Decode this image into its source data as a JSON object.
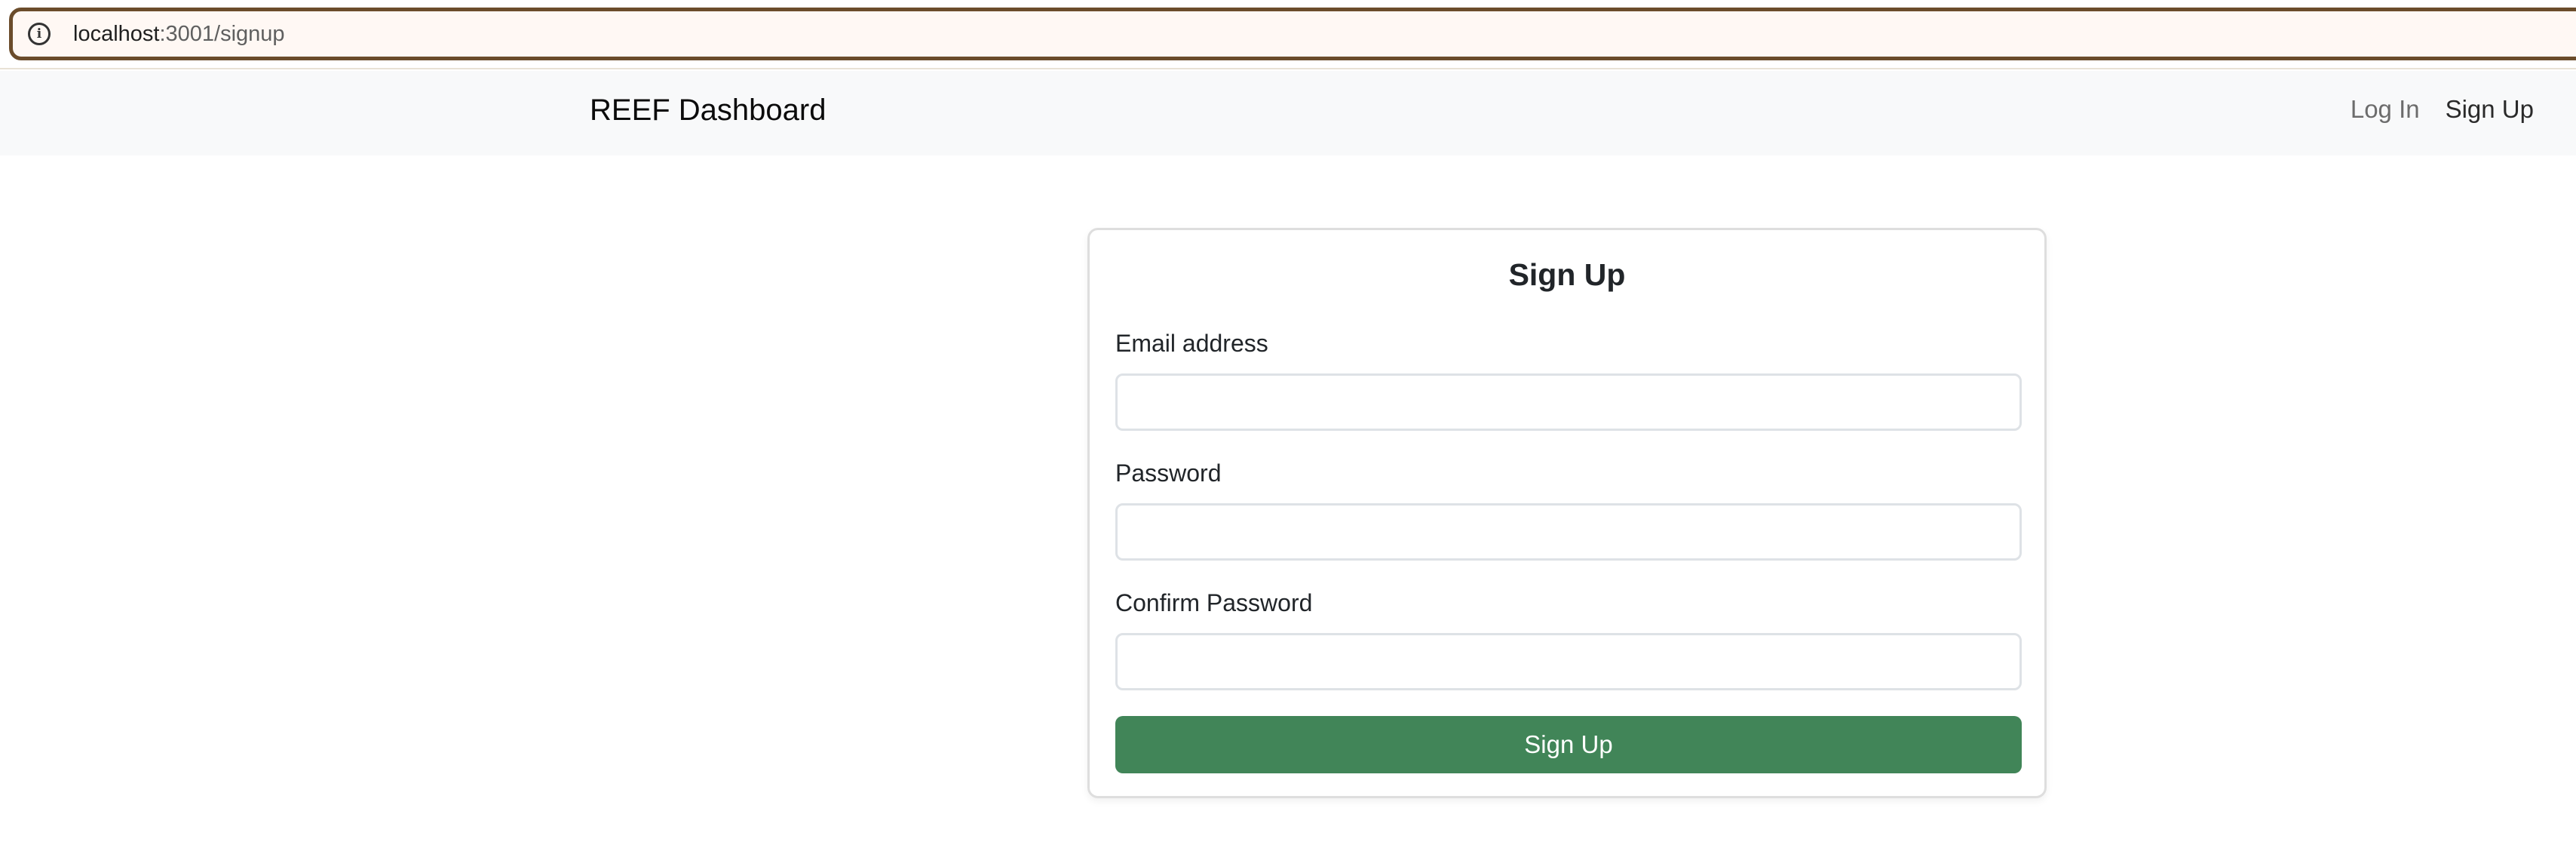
{
  "browser": {
    "url_host": "localhost",
    "url_path": ":3001/signup"
  },
  "navbar": {
    "brand": "REEF Dashboard",
    "links": [
      {
        "label": "Log In"
      },
      {
        "label": "Sign Up"
      }
    ]
  },
  "form": {
    "title": "Sign Up",
    "email_label": "Email address",
    "email_value": "",
    "password_label": "Password",
    "password_value": "",
    "confirm_label": "Confirm Password",
    "confirm_value": "",
    "submit_label": "Sign Up"
  },
  "colors": {
    "primary_button": "#418558",
    "navbar_bg": "#f8f9fa",
    "address_border": "#6b4c2b"
  }
}
